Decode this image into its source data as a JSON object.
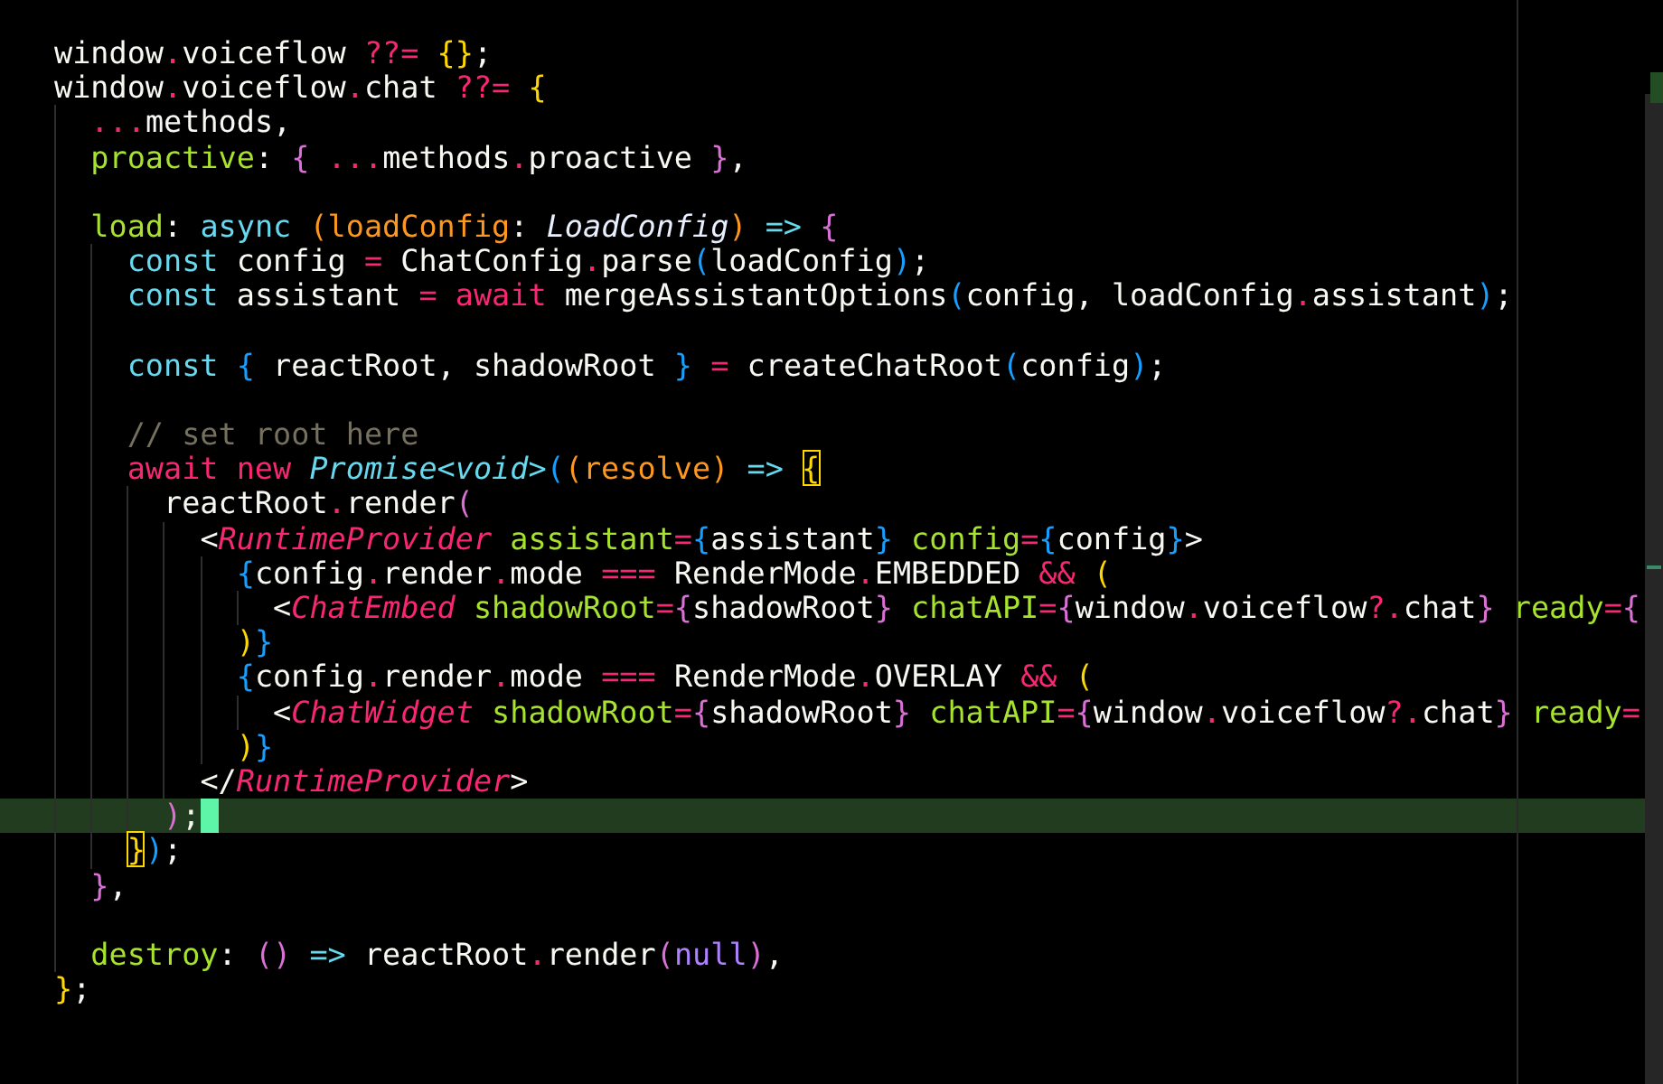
{
  "lines": [
    {
      "kind": "code",
      "tokens": [
        {
          "text": "window",
          "kind": "p"
        },
        {
          "text": ".",
          "kind": "op"
        },
        {
          "text": "voiceflow ",
          "kind": "p"
        },
        {
          "text": "??= ",
          "kind": "op"
        },
        {
          "text": "{}",
          "kind": "b1"
        },
        {
          "text": ";",
          "kind": "p"
        }
      ]
    },
    {
      "kind": "code",
      "tokens": [
        {
          "text": "window",
          "kind": "p"
        },
        {
          "text": ".",
          "kind": "op"
        },
        {
          "text": "voiceflow",
          "kind": "p"
        },
        {
          "text": ".",
          "kind": "op"
        },
        {
          "text": "chat ",
          "kind": "p"
        },
        {
          "text": "??= ",
          "kind": "op"
        },
        {
          "text": "{",
          "kind": "b1"
        }
      ]
    },
    {
      "kind": "code",
      "tokens": [
        {
          "text": "  ...",
          "kind": "op"
        },
        {
          "text": "methods,",
          "kind": "p"
        }
      ]
    },
    {
      "kind": "code",
      "tokens": [
        {
          "text": "  proactive",
          "kind": "pr"
        },
        {
          "text": ": ",
          "kind": "p"
        },
        {
          "text": "{",
          "kind": "b2"
        },
        {
          "text": " ...",
          "kind": "op"
        },
        {
          "text": "methods",
          "kind": "p"
        },
        {
          "text": ".",
          "kind": "op"
        },
        {
          "text": "proactive ",
          "kind": "p"
        },
        {
          "text": "}",
          "kind": "b2"
        },
        {
          "text": ",",
          "kind": "p"
        }
      ]
    },
    {
      "kind": "blank"
    },
    {
      "kind": "code",
      "tokens": [
        {
          "text": "  load",
          "kind": "pr"
        },
        {
          "text": ": ",
          "kind": "p"
        },
        {
          "text": "async ",
          "kind": "st"
        },
        {
          "text": "(loadConfig",
          "kind": "pa"
        },
        {
          "text": ": ",
          "kind": "p"
        },
        {
          "text": "LoadConfig",
          "kind": "tr"
        },
        {
          "text": ") ",
          "kind": "pa"
        },
        {
          "text": "=> ",
          "kind": "st"
        },
        {
          "text": "{",
          "kind": "b2"
        }
      ]
    },
    {
      "kind": "code",
      "tokens": [
        {
          "text": "    const",
          "kind": "st"
        },
        {
          "text": " config ",
          "kind": "p"
        },
        {
          "text": "=",
          "kind": "op"
        },
        {
          "text": " ChatConfig",
          "kind": "p"
        },
        {
          "text": ".",
          "kind": "op"
        },
        {
          "text": "parse",
          "kind": "p"
        },
        {
          "text": "(",
          "kind": "b3"
        },
        {
          "text": "loadConfig",
          "kind": "p"
        },
        {
          "text": ")",
          "kind": "b3"
        },
        {
          "text": ";",
          "kind": "p"
        }
      ]
    },
    {
      "kind": "code",
      "tokens": [
        {
          "text": "    const",
          "kind": "st"
        },
        {
          "text": " assistant ",
          "kind": "p"
        },
        {
          "text": "= await",
          "kind": "op"
        },
        {
          "text": " mergeAssistantOptions",
          "kind": "p"
        },
        {
          "text": "(",
          "kind": "b3"
        },
        {
          "text": "config, loadConfig",
          "kind": "p"
        },
        {
          "text": ".",
          "kind": "op"
        },
        {
          "text": "assistant",
          "kind": "p"
        },
        {
          "text": ")",
          "kind": "b3"
        },
        {
          "text": ";",
          "kind": "p"
        }
      ]
    },
    {
      "kind": "blank"
    },
    {
      "kind": "code",
      "tokens": [
        {
          "text": "    const ",
          "kind": "st"
        },
        {
          "text": "{",
          "kind": "b3"
        },
        {
          "text": " reactRoot, shadowRoot ",
          "kind": "p"
        },
        {
          "text": "}",
          "kind": "b3"
        },
        {
          "text": " =",
          "kind": "op"
        },
        {
          "text": " createChatRoot",
          "kind": "p"
        },
        {
          "text": "(",
          "kind": "b3"
        },
        {
          "text": "config",
          "kind": "p"
        },
        {
          "text": ")",
          "kind": "b3"
        },
        {
          "text": ";",
          "kind": "p"
        }
      ]
    },
    {
      "kind": "blank"
    },
    {
      "kind": "code",
      "tokens": [
        {
          "text": "    // set root here",
          "kind": "cm"
        }
      ]
    },
    {
      "kind": "code",
      "tokens": [
        {
          "text": "    await new ",
          "kind": "op"
        },
        {
          "text": "Promise<void>",
          "kind": "ty"
        },
        {
          "text": "(",
          "kind": "b3"
        },
        {
          "text": "(resolve) ",
          "kind": "pa"
        },
        {
          "text": "=> ",
          "kind": "st"
        },
        {
          "text": "{",
          "kind": "b1",
          "match": true
        }
      ]
    },
    {
      "kind": "code",
      "tokens": [
        {
          "text": "      reactRoot",
          "kind": "p"
        },
        {
          "text": ".",
          "kind": "op"
        },
        {
          "text": "render",
          "kind": "p"
        },
        {
          "text": "(",
          "kind": "b2"
        }
      ]
    },
    {
      "kind": "code",
      "tokens": [
        {
          "text": "        <",
          "kind": "p"
        },
        {
          "text": "RuntimeProvider",
          "kind": "tg"
        },
        {
          "text": " assistant",
          "kind": "pr"
        },
        {
          "text": "=",
          "kind": "op"
        },
        {
          "text": "{",
          "kind": "b3"
        },
        {
          "text": "assistant",
          "kind": "p"
        },
        {
          "text": "}",
          "kind": "b3"
        },
        {
          "text": " config",
          "kind": "pr"
        },
        {
          "text": "=",
          "kind": "op"
        },
        {
          "text": "{",
          "kind": "b3"
        },
        {
          "text": "config",
          "kind": "p"
        },
        {
          "text": "}",
          "kind": "b3"
        },
        {
          "text": ">",
          "kind": "p"
        }
      ]
    },
    {
      "kind": "code",
      "tokens": [
        {
          "text": "          {",
          "kind": "b3"
        },
        {
          "text": "config",
          "kind": "p"
        },
        {
          "text": ".",
          "kind": "op"
        },
        {
          "text": "render",
          "kind": "p"
        },
        {
          "text": ".",
          "kind": "op"
        },
        {
          "text": "mode ",
          "kind": "p"
        },
        {
          "text": "===",
          "kind": "op"
        },
        {
          "text": " RenderMode",
          "kind": "p"
        },
        {
          "text": ".",
          "kind": "op"
        },
        {
          "text": "EMBEDDED ",
          "kind": "p"
        },
        {
          "text": "&& ",
          "kind": "op"
        },
        {
          "text": "(",
          "kind": "b1"
        }
      ]
    },
    {
      "kind": "code",
      "tokens": [
        {
          "text": "            <",
          "kind": "p"
        },
        {
          "text": "ChatEmbed",
          "kind": "tg"
        },
        {
          "text": " shadowRoot",
          "kind": "pr"
        },
        {
          "text": "=",
          "kind": "op"
        },
        {
          "text": "{",
          "kind": "b2"
        },
        {
          "text": "shadowRoot",
          "kind": "p"
        },
        {
          "text": "}",
          "kind": "b2"
        },
        {
          "text": " chatAPI",
          "kind": "pr"
        },
        {
          "text": "=",
          "kind": "op"
        },
        {
          "text": "{",
          "kind": "b2"
        },
        {
          "text": "window",
          "kind": "p"
        },
        {
          "text": ".",
          "kind": "op"
        },
        {
          "text": "voiceflow",
          "kind": "p"
        },
        {
          "text": "?.",
          "kind": "op"
        },
        {
          "text": "chat",
          "kind": "p"
        },
        {
          "text": "}",
          "kind": "b2"
        },
        {
          "text": " ready",
          "kind": "pr"
        },
        {
          "text": "=",
          "kind": "op"
        },
        {
          "text": "{",
          "kind": "b2"
        }
      ]
    },
    {
      "kind": "code",
      "tokens": [
        {
          "text": "          )",
          "kind": "b1"
        },
        {
          "text": "}",
          "kind": "b3"
        }
      ]
    },
    {
      "kind": "code",
      "tokens": [
        {
          "text": "          {",
          "kind": "b3"
        },
        {
          "text": "config",
          "kind": "p"
        },
        {
          "text": ".",
          "kind": "op"
        },
        {
          "text": "render",
          "kind": "p"
        },
        {
          "text": ".",
          "kind": "op"
        },
        {
          "text": "mode ",
          "kind": "p"
        },
        {
          "text": "===",
          "kind": "op"
        },
        {
          "text": " RenderMode",
          "kind": "p"
        },
        {
          "text": ".",
          "kind": "op"
        },
        {
          "text": "OVERLAY ",
          "kind": "p"
        },
        {
          "text": "&& ",
          "kind": "op"
        },
        {
          "text": "(",
          "kind": "b1"
        }
      ]
    },
    {
      "kind": "code",
      "tokens": [
        {
          "text": "            <",
          "kind": "p"
        },
        {
          "text": "ChatWidget",
          "kind": "tg"
        },
        {
          "text": " shadowRoot",
          "kind": "pr"
        },
        {
          "text": "=",
          "kind": "op"
        },
        {
          "text": "{",
          "kind": "b2"
        },
        {
          "text": "shadowRoot",
          "kind": "p"
        },
        {
          "text": "}",
          "kind": "b2"
        },
        {
          "text": " chatAPI",
          "kind": "pr"
        },
        {
          "text": "=",
          "kind": "op"
        },
        {
          "text": "{",
          "kind": "b2"
        },
        {
          "text": "window",
          "kind": "p"
        },
        {
          "text": ".",
          "kind": "op"
        },
        {
          "text": "voiceflow",
          "kind": "p"
        },
        {
          "text": "?.",
          "kind": "op"
        },
        {
          "text": "chat",
          "kind": "p"
        },
        {
          "text": "}",
          "kind": "b2"
        },
        {
          "text": " ready",
          "kind": "pr"
        },
        {
          "text": "=",
          "kind": "op"
        }
      ]
    },
    {
      "kind": "code",
      "tokens": [
        {
          "text": "          )",
          "kind": "b1"
        },
        {
          "text": "}",
          "kind": "b3"
        }
      ]
    },
    {
      "kind": "code",
      "tokens": [
        {
          "text": "        </",
          "kind": "p"
        },
        {
          "text": "RuntimeProvider",
          "kind": "tg"
        },
        {
          "text": ">",
          "kind": "p"
        }
      ]
    },
    {
      "kind": "code",
      "current": true,
      "tokens": [
        {
          "text": "      )",
          "kind": "b2"
        },
        {
          "text": ";",
          "kind": "p"
        }
      ]
    },
    {
      "kind": "code",
      "tokens": [
        {
          "text": "    }",
          "kind": "b1",
          "match": true
        },
        {
          "text": ")",
          "kind": "b3"
        },
        {
          "text": ";",
          "kind": "p"
        }
      ]
    },
    {
      "kind": "code",
      "tokens": [
        {
          "text": "  }",
          "kind": "b2"
        },
        {
          "text": ",",
          "kind": "p"
        }
      ]
    },
    {
      "kind": "blank"
    },
    {
      "kind": "code",
      "tokens": [
        {
          "text": "  destroy",
          "kind": "pr"
        },
        {
          "text": ": ",
          "kind": "p"
        },
        {
          "text": "()",
          "kind": "b2"
        },
        {
          "text": " =>",
          "kind": "st"
        },
        {
          "text": " reactRoot",
          "kind": "p"
        },
        {
          "text": ".",
          "kind": "op"
        },
        {
          "text": "render",
          "kind": "p"
        },
        {
          "text": "(",
          "kind": "b2"
        },
        {
          "text": "null",
          "kind": "nu"
        },
        {
          "text": ")",
          "kind": "b2"
        },
        {
          "text": ",",
          "kind": "p"
        }
      ]
    },
    {
      "kind": "code",
      "tokens": [
        {
          "text": "}",
          "kind": "b1"
        },
        {
          "text": ";",
          "kind": "p"
        }
      ]
    }
  ]
}
